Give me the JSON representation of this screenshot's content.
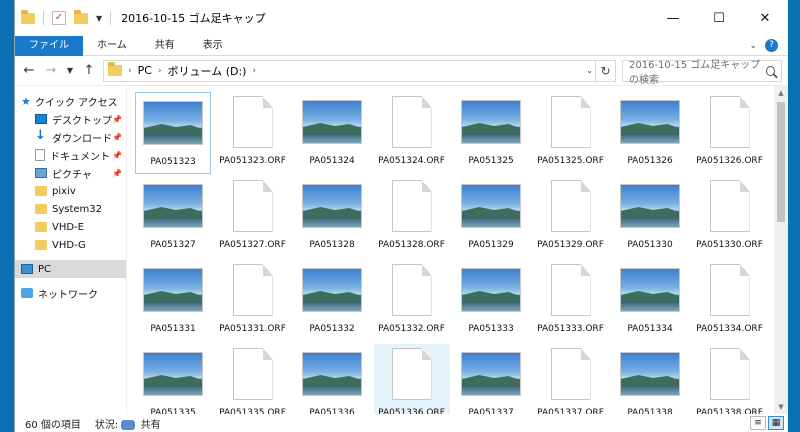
{
  "window": {
    "title": "2016-10-15 ゴム足キャップ"
  },
  "ribbon": {
    "tabs": [
      "ファイル",
      "ホーム",
      "共有",
      "表示"
    ]
  },
  "address": {
    "crumbs": [
      "PC",
      "ボリューム (D:)"
    ]
  },
  "search": {
    "placeholder": "2016-10-15 ゴム足キャップの検索"
  },
  "sidebar": {
    "quick_access": "クイック アクセス",
    "pinned": [
      "デスクトップ",
      "ダウンロード",
      "ドキュメント",
      "ピクチャ"
    ],
    "folders": [
      "pixiv",
      "System32",
      "VHD-E",
      "VHD-G"
    ],
    "pc": "PC",
    "network": "ネットワーク"
  },
  "files": [
    {
      "name": "PA051323",
      "type": "image"
    },
    {
      "name": "PA051323.ORF",
      "type": "raw"
    },
    {
      "name": "PA051324",
      "type": "image"
    },
    {
      "name": "PA051324.ORF",
      "type": "raw"
    },
    {
      "name": "PA051325",
      "type": "image"
    },
    {
      "name": "PA051325.ORF",
      "type": "raw"
    },
    {
      "name": "PA051326",
      "type": "image"
    },
    {
      "name": "PA051326.ORF",
      "type": "raw"
    },
    {
      "name": "PA051327",
      "type": "image"
    },
    {
      "name": "PA051327.ORF",
      "type": "raw"
    },
    {
      "name": "PA051328",
      "type": "image"
    },
    {
      "name": "PA051328.ORF",
      "type": "raw"
    },
    {
      "name": "PA051329",
      "type": "image"
    },
    {
      "name": "PA051329.ORF",
      "type": "raw"
    },
    {
      "name": "PA051330",
      "type": "image"
    },
    {
      "name": "PA051330.ORF",
      "type": "raw"
    },
    {
      "name": "PA051331",
      "type": "image"
    },
    {
      "name": "PA051331.ORF",
      "type": "raw"
    },
    {
      "name": "PA051332",
      "type": "image"
    },
    {
      "name": "PA051332.ORF",
      "type": "raw"
    },
    {
      "name": "PA051333",
      "type": "image"
    },
    {
      "name": "PA051333.ORF",
      "type": "raw"
    },
    {
      "name": "PA051334",
      "type": "image"
    },
    {
      "name": "PA051334.ORF",
      "type": "raw"
    },
    {
      "name": "PA051335",
      "type": "image"
    },
    {
      "name": "PA051335.ORF",
      "type": "raw"
    },
    {
      "name": "PA051336",
      "type": "image"
    },
    {
      "name": "PA051336.ORF",
      "type": "raw"
    },
    {
      "name": "PA051337",
      "type": "image"
    },
    {
      "name": "PA051337.ORF",
      "type": "raw"
    },
    {
      "name": "PA051338",
      "type": "image"
    },
    {
      "name": "PA051338.ORF",
      "type": "raw"
    }
  ],
  "status": {
    "count": "60 個の項目",
    "state_label": "状況:",
    "state_value": "共有"
  },
  "colors": {
    "accent": "#1979ca",
    "desktop": "#0b6fb4"
  },
  "icons": [
    "back-icon",
    "forward-icon",
    "up-icon",
    "refresh-icon",
    "search-icon",
    "star-icon",
    "pin-icon"
  ]
}
